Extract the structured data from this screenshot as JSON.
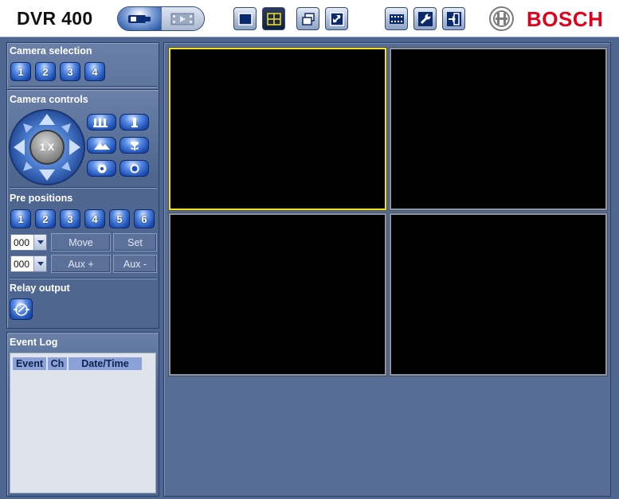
{
  "header": {
    "title": "DVR 400",
    "brand": "BOSCH",
    "buttons": [
      "live-view",
      "playback",
      "single-view",
      "quad-view",
      "multi-window",
      "fullscreen",
      "export",
      "settings",
      "logout"
    ]
  },
  "camera_selection": {
    "title": "Camera selection",
    "cameras": [
      "1",
      "2",
      "3",
      "4"
    ]
  },
  "camera_controls": {
    "title": "Camera controls",
    "zoom_label": "1 X"
  },
  "pre_positions": {
    "title": "Pre positions",
    "presets": [
      "1",
      "2",
      "3",
      "4",
      "5",
      "6"
    ],
    "position_value": "000",
    "aux_value": "000",
    "move_label": "Move",
    "set_label": "Set",
    "aux_plus_label": "Aux +",
    "aux_minus_label": "Aux -"
  },
  "relay": {
    "title": "Relay output"
  },
  "event_log": {
    "title": "Event Log",
    "columns": [
      "Event",
      "Ch",
      "Date/Time"
    ]
  },
  "colors": {
    "accent": "#1d4fb5",
    "brand_red": "#e2001a",
    "active_tile": "#f4e21c",
    "panel": "#4f6790"
  }
}
